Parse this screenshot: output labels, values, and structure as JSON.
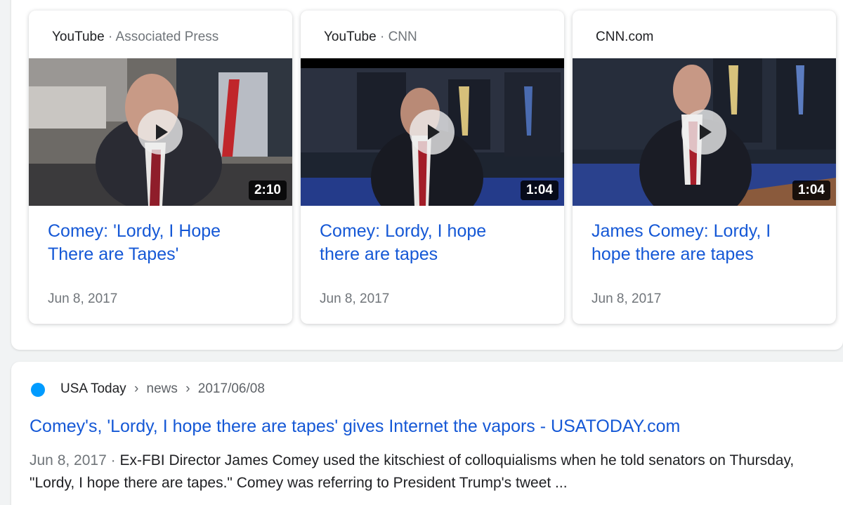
{
  "video_cards": [
    {
      "source": "YouTube",
      "sub_source": "Associated Press",
      "duration": "2:10",
      "title": "Comey: 'Lordy, I Hope There are Tapes'",
      "date": "Jun 8, 2017"
    },
    {
      "source": "YouTube",
      "sub_source": "CNN",
      "duration": "1:04",
      "title": "Comey: Lordy, I hope there are tapes",
      "date": "Jun 8, 2017"
    },
    {
      "source": "CNN.com",
      "sub_source": "",
      "duration": "1:04",
      "title": "James Comey: Lordy, I hope there are tapes",
      "date": "Jun 8, 2017"
    }
  ],
  "separator": "·",
  "result": {
    "site": "USA Today",
    "crumbs": [
      "news",
      "2017/06/08"
    ],
    "crumb_separator": "›",
    "title": "Comey's, 'Lordy, I hope there are tapes' gives Internet the vapors - USATODAY.com",
    "date": "Jun 8, 2017",
    "snippet_separator": "·",
    "snippet": "Ex-FBI Director James Comey used the kitschiest of colloquialisms when he told senators on Thursday, \"Lordy, I hope there are tapes.\" Comey was referring to President Trump's tweet ..."
  },
  "colors": {
    "link": "#1558d6",
    "favicon": "#009bff",
    "muted": "#70757a"
  }
}
